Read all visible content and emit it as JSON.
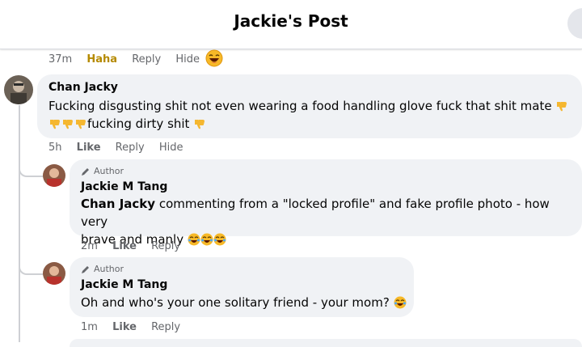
{
  "header": {
    "title": "Jackie's Post"
  },
  "top_meta": {
    "time": "37m",
    "reaction": "Haha",
    "reply": "Reply",
    "hide": "Hide"
  },
  "comment1": {
    "name": "Chan Jacky",
    "line1": "Fucking disgusting shit not even wearing a food handling glove fuck that shit mate",
    "line2": "fucking dirty shit",
    "meta": {
      "time": "5h",
      "like": "Like",
      "reply": "Reply",
      "hide": "Hide"
    }
  },
  "reply1": {
    "badge": "Author",
    "name": "Jackie M Tang",
    "mention": "Chan Jacky",
    "text_line1": " commenting from a \"locked profile\" and fake profile photo - how very",
    "text_line2": "brave and manly",
    "meta": {
      "time": "2m",
      "like": "Like",
      "reply": "Reply"
    }
  },
  "reply2": {
    "badge": "Author",
    "name": "Jackie M Tang",
    "text": "Oh and who's your one solitary friend - your mom?",
    "meta": {
      "time": "1m",
      "like": "Like",
      "reply": "Reply"
    }
  },
  "colors": {
    "bubble": "#f0f2f5",
    "meta_text": "#65676b",
    "haha": "#b58a00"
  },
  "icons": [
    "laughing-face-icon",
    "thumbs-down-icon",
    "pencil-icon",
    "tears-of-joy-icon"
  ]
}
